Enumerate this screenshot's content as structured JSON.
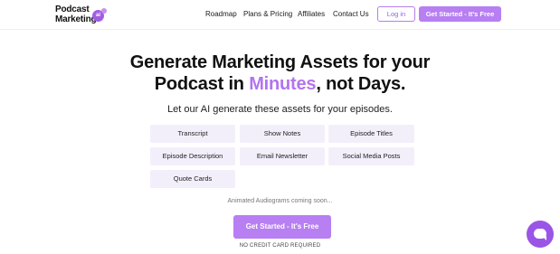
{
  "logo": {
    "line1": "Podcast",
    "line2": "Marketing",
    "badge": "ai"
  },
  "nav": {
    "roadmap": "Roadmap",
    "plans": "Plans & Pricing",
    "affiliates": "Affiliates",
    "contact": "Contact Us"
  },
  "header": {
    "login_label": "Log in",
    "cta_label": "Get Started - It's Free"
  },
  "hero": {
    "line1": "Generate Marketing Assets for your",
    "line2_before": "Podcast in ",
    "line2_accent": "Minutes",
    "line2_after": ", not Days.",
    "subtitle": "Let our AI generate these assets for your episodes."
  },
  "assets": [
    "Transcript",
    "Show Notes",
    "Episode Titles",
    "Episode Description",
    "Email Newsletter",
    "Social Media Posts",
    "Quote Cards"
  ],
  "coming_soon": "Animated Audiograms coming soon...",
  "main_cta_label": "Get Started - It's Free",
  "no_credit_card": "NO CREDIT CARD REQUIRED",
  "chat": {
    "icon": "chat-icon"
  },
  "colors": {
    "accent": "#b77ff2",
    "accent_text": "#b274ee",
    "chip_bg": "#f3effa",
    "chat": "#9a55e6"
  }
}
